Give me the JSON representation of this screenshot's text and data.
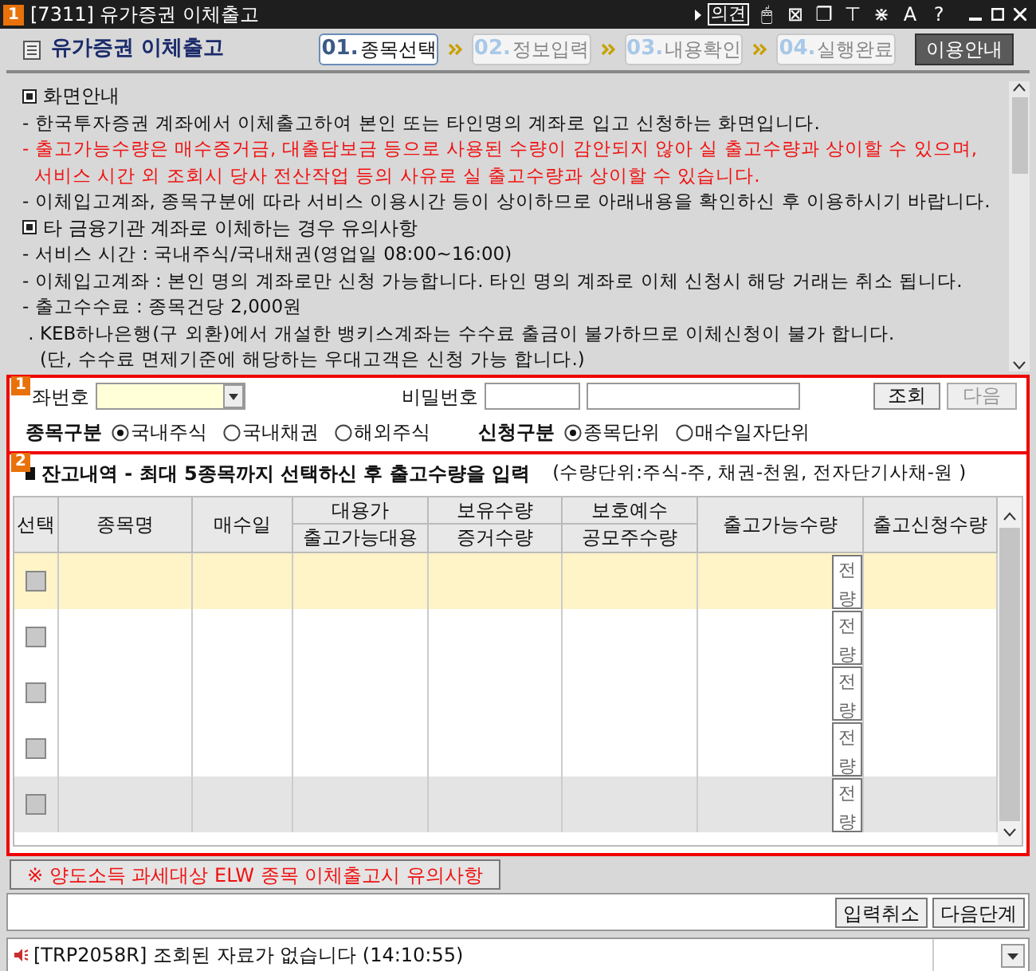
{
  "window": {
    "badge": "1",
    "title": "[7311] 유가증권 이체출고",
    "tools": [
      {
        "label": "의견",
        "kind": "text"
      },
      {
        "label": "🖱",
        "kind": "glyph"
      },
      {
        "label": "⊠",
        "kind": "glyph"
      },
      {
        "label": "❐",
        "kind": "glyph"
      },
      {
        "label": "⊤",
        "kind": "glyph"
      },
      {
        "label": "⋇",
        "kind": "glyph"
      },
      {
        "label": "A",
        "kind": "glyph"
      },
      {
        "label": "?",
        "kind": "glyph"
      }
    ]
  },
  "header": {
    "title": "유가증권 이체출고",
    "steps": [
      {
        "num": "01.",
        "label": "종목선택",
        "selected": true
      },
      {
        "num": "02.",
        "label": "정보입력",
        "selected": false
      },
      {
        "num": "03.",
        "label": "내용확인",
        "selected": false
      },
      {
        "num": "04.",
        "label": "실행완료",
        "selected": false
      }
    ],
    "guide_button": "이용안내"
  },
  "notice": [
    {
      "kind": "heading",
      "text": "화면안내"
    },
    {
      "kind": "line",
      "text": "- 한국투자증권 계좌에서 이체출고하여 본인 또는 타인명의 계좌로 입고 신청하는 화면입니다."
    },
    {
      "kind": "warning",
      "text": "- 출고가능수량은 매수증거금, 대출담보금 등으로 사용된 수량이 감안되지 않아 실 출고수량과 상이할 수 있으며,"
    },
    {
      "kind": "warning",
      "text": "  서비스 시간 외 조회시 당사 전산작업 등의 사유로 실 출고수량과 상이할 수 있습니다."
    },
    {
      "kind": "line",
      "text": "- 이체입고계좌, 종목구분에 따라 서비스 이용시간 등이 상이하므로 아래내용을 확인하신 후 이용하시기 바랍니다."
    },
    {
      "kind": "heading",
      "text": "타 금융기관 계좌로 이체하는 경우 유의사항"
    },
    {
      "kind": "line",
      "text": "- 서비스 시간 : 국내주식/국내채권(영업일 08:00~16:00)"
    },
    {
      "kind": "line",
      "text": "- 이체입고계좌 : 본인 명의 계좌로만 신청 가능합니다. 타인 명의 계좌로 이체 신청시 해당 거래는 취소 됩니다."
    },
    {
      "kind": "line",
      "text": "- 출고수수료 : 종목건당 2,000원"
    },
    {
      "kind": "line",
      "text": " . KEB하나은행(구 외환)에서 개설한 뱅키스계좌는 수수료 출금이 불가하므로 이체신청이 불가 합니다."
    },
    {
      "kind": "line",
      "text": "   (단, 수수료 면제기준에 해당하는 우대고객은 신청 가능 합니다.)"
    }
  ],
  "section1": {
    "badge": "1",
    "account_label": "좌번호",
    "password_label": "비밀번호",
    "query_button": "조회",
    "next_button": {
      "label": "다음",
      "disabled": true
    },
    "groups": [
      {
        "label": "종목구분",
        "options": [
          {
            "label": "국내주식",
            "selected": true
          },
          {
            "label": "국내채권",
            "selected": false
          },
          {
            "label": "해외주식",
            "selected": false
          }
        ]
      },
      {
        "label": "신청구분",
        "options": [
          {
            "label": "종목단위",
            "selected": true
          },
          {
            "label": "매수일자단위",
            "selected": false
          }
        ]
      }
    ]
  },
  "section2": {
    "badge": "2",
    "title": "잔고내역 - 최대 5종목까지 선택하신 후 출고수량을 입력",
    "unit_note": "(수량단위:주식-주, 채권-천원, 전자단기사채-원 )",
    "columns": [
      {
        "top": "선택"
      },
      {
        "top": "종목명"
      },
      {
        "top": "매수일"
      },
      {
        "top": "대용가",
        "bottom": "출고가능대용"
      },
      {
        "top": "보유수량",
        "bottom": "증거수량"
      },
      {
        "top": "보호예수",
        "bottom": "공모주수량"
      },
      {
        "top": "출고가능수량"
      },
      {
        "top": "출고신청수량"
      }
    ],
    "rows": [
      {
        "selected": true,
        "shaded": false,
        "checked": false,
        "all_button": "전량"
      },
      {
        "selected": false,
        "shaded": false,
        "checked": false,
        "all_button": "전량"
      },
      {
        "selected": false,
        "shaded": false,
        "checked": false,
        "all_button": "전량"
      },
      {
        "selected": false,
        "shaded": false,
        "checked": false,
        "all_button": "전량"
      },
      {
        "selected": false,
        "shaded": true,
        "checked": false,
        "all_button": "전량"
      }
    ]
  },
  "elw_notice_button": "※ 양도소득 과세대상 ELW 종목 이체출고시 유의사항",
  "actions": [
    "입력취소",
    "다음단계"
  ],
  "status_bar": {
    "message": "[TRP2058R] 조회된 자료가 없습니다 (14:10:55)"
  }
}
